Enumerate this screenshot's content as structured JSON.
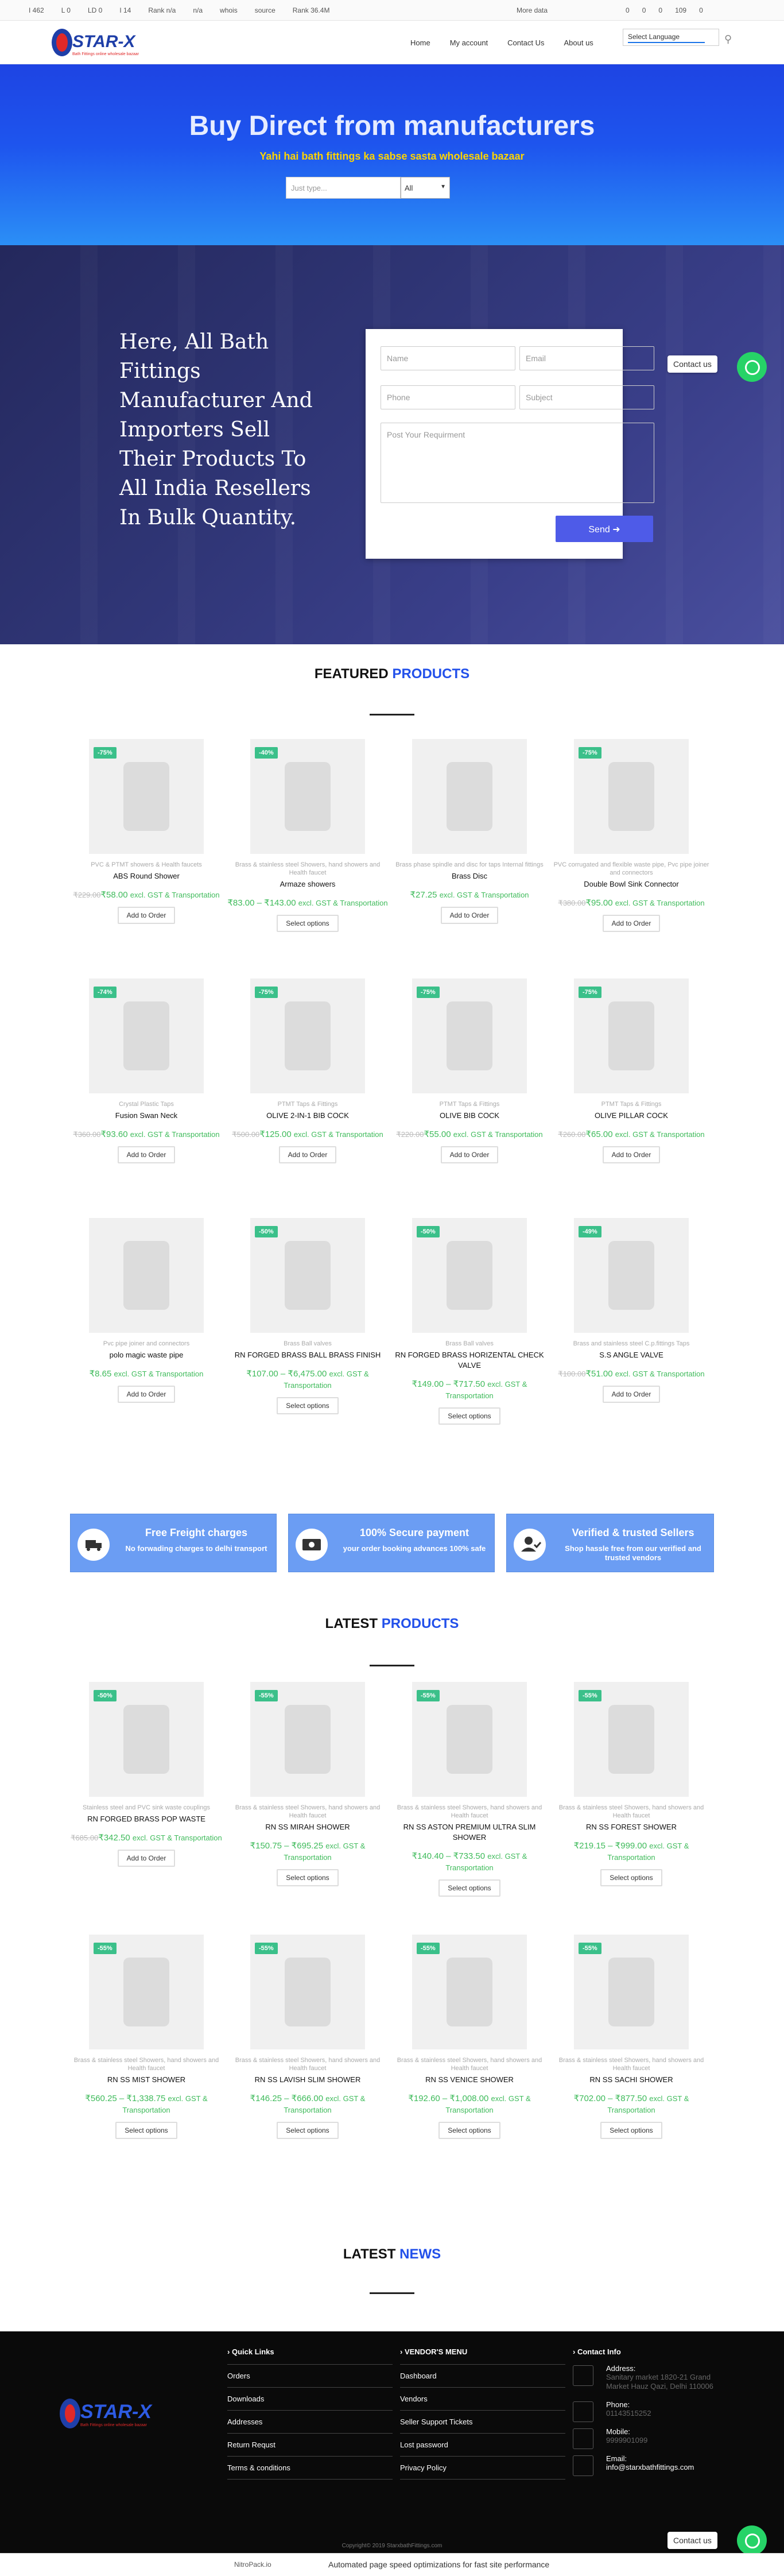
{
  "seo_bar": {
    "items": [
      {
        "icon": "google-icon",
        "label": "I 462"
      },
      {
        "icon": "pin-icon",
        "label": "L 0"
      },
      {
        "icon": "ld-icon",
        "label": "LD 0"
      },
      {
        "icon": "ext-icon",
        "label": "I 14"
      },
      {
        "icon": "rank-icon",
        "label": "Rank n/a"
      },
      {
        "icon": "facebook-icon",
        "label": "n/a"
      },
      {
        "icon": "whois-icon",
        "label": "whois"
      },
      {
        "icon": "source-icon",
        "label": "source"
      },
      {
        "icon": "rank2-icon",
        "label": "Rank 36.4M"
      }
    ],
    "more": "More data",
    "counts": [
      "0",
      "0",
      "0",
      "109",
      "0"
    ]
  },
  "header": {
    "logo_text": "STAR-X",
    "logo_tagline": "Bath Fittings online wholesale bazaar",
    "nav": [
      "Home",
      "My account",
      "Contact Us",
      "About us"
    ],
    "language": "Select Language"
  },
  "hero": {
    "title": "Buy Direct from manufacturers",
    "subtitle": "Yahi hai bath fittings ka sabse sasta wholesale bazaar",
    "search_placeholder": "Just type...",
    "search_select": "All"
  },
  "enquiry": {
    "headline": "Here, All Bath Fittings Manufacturer And Importers Sell Their Products To All India Resellers In Bulk Quantity.",
    "name": "Name",
    "email": "Email",
    "phone": "Phone",
    "subject": "Subject",
    "requirement": "Post Your Requirment",
    "send": "Send",
    "contact_label": "Contact us"
  },
  "featured": {
    "title_a": "FEATURED",
    "title_b": "PRODUCTS",
    "products": [
      {
        "badge": "-75%",
        "cat": "PVC & PTMT showers & Health faucets",
        "name": "ABS Round Shower",
        "old": "₹229.00",
        "price": "₹58.00",
        "tax": "excl. GST & Transportation",
        "btn": "Add to Order"
      },
      {
        "badge": "-40%",
        "cat": "Brass & stainless steel Showers, hand showers and Health faucet",
        "name": "Armaze showers",
        "old": "",
        "price": "₹83.00 – ₹143.00",
        "tax": "excl. GST & Transportation",
        "btn": "Select options"
      },
      {
        "badge": "",
        "cat": "Brass phase spindle and disc for taps Internal fittings",
        "name": "Brass Disc",
        "old": "",
        "price": "₹27.25",
        "tax": "excl. GST & Transportation",
        "btn": "Add to Order"
      },
      {
        "badge": "-75%",
        "cat": "PVC corrugated and flexible waste pipe, Pvc pipe joiner and connectors",
        "name": "Double Bowl Sink Connector",
        "old": "₹380.00",
        "price": "₹95.00",
        "tax": "excl. GST & Transportation",
        "btn": "Add to Order"
      },
      {
        "badge": "-74%",
        "cat": "Crystal Plastic Taps",
        "name": "Fusion Swan Neck",
        "old": "₹360.00",
        "price": "₹93.60",
        "tax": "excl. GST & Transportation",
        "btn": "Add to Order"
      },
      {
        "badge": "-75%",
        "cat": "PTMT Taps & Fittings",
        "name": "OLIVE 2-IN-1 BIB COCK",
        "old": "₹500.00",
        "price": "₹125.00",
        "tax": "excl. GST & Transportation",
        "btn": "Add to Order"
      },
      {
        "badge": "-75%",
        "cat": "PTMT Taps & Fittings",
        "name": "OLIVE BIB COCK",
        "old": "₹220.00",
        "price": "₹55.00",
        "tax": "excl. GST & Transportation",
        "btn": "Add to Order"
      },
      {
        "badge": "-75%",
        "cat": "PTMT Taps & Fittings",
        "name": "OLIVE PILLAR COCK",
        "old": "₹260.00",
        "price": "₹65.00",
        "tax": "excl. GST & Transportation",
        "btn": "Add to Order"
      },
      {
        "badge": "",
        "cat": "Pvc pipe joiner and connectors",
        "name": "polo magic waste pipe",
        "old": "",
        "price": "₹8.65",
        "tax": "excl. GST & Transportation",
        "btn": "Add to Order"
      },
      {
        "badge": "-50%",
        "cat": "Brass Ball valves",
        "name": "RN FORGED BRASS BALL BRASS FINISH",
        "old": "",
        "price": "₹107.00 – ₹6,475.00",
        "tax": "excl. GST & Transportation",
        "btn": "Select options"
      },
      {
        "badge": "-50%",
        "cat": "Brass Ball valves",
        "name": "RN FORGED BRASS HORIZENTAL CHECK VALVE",
        "old": "",
        "price": "₹149.00 – ₹717.50",
        "tax": "excl. GST & Transportation",
        "btn": "Select options"
      },
      {
        "badge": "-49%",
        "cat": "Brass and stainless steel C.p.fittings Taps",
        "name": "S.S ANGLE VALVE",
        "old": "₹100.00",
        "price": "₹51.00",
        "tax": "excl. GST & Transportation",
        "btn": "Add to Order"
      }
    ]
  },
  "features": [
    {
      "icon": "truck-icon",
      "title": "Free Freight charges",
      "text": "No forwading charges to delhi transport"
    },
    {
      "icon": "money-icon",
      "title": "100% Secure payment",
      "text": "your order booking advances 100% safe"
    },
    {
      "icon": "user-check-icon",
      "title": "Verified & trusted Sellers",
      "text": "Shop hassle free from our verified and trusted vendors"
    }
  ],
  "latest": {
    "title_a": "LATEST",
    "title_b": "PRODUCTS",
    "products": [
      {
        "badge": "-50%",
        "cat": "Stainless steel and PVC sink waste couplings",
        "name": "RN FORGED BRASS POP WASTE",
        "old": "₹685.00",
        "price": "₹342.50",
        "tax": "excl. GST & Transportation",
        "btn": "Add to Order"
      },
      {
        "badge": "-55%",
        "cat": "Brass & stainless steel Showers, hand showers and Health faucet",
        "name": "RN SS MIRAH SHOWER",
        "old": "",
        "price": "₹150.75 – ₹695.25",
        "tax": "excl. GST & Transportation",
        "btn": "Select options"
      },
      {
        "badge": "-55%",
        "cat": "Brass & stainless steel Showers, hand showers and Health faucet",
        "name": "RN SS ASTON PREMIUM ULTRA SLIM SHOWER",
        "old": "",
        "price": "₹140.40 – ₹733.50",
        "tax": "excl. GST & Transportation",
        "btn": "Select options"
      },
      {
        "badge": "-55%",
        "cat": "Brass & stainless steel Showers, hand showers and Health faucet",
        "name": "RN SS FOREST SHOWER",
        "old": "",
        "price": "₹219.15 – ₹999.00",
        "tax": "excl. GST & Transportation",
        "btn": "Select options"
      },
      {
        "badge": "-55%",
        "cat": "Brass & stainless steel Showers, hand showers and Health faucet",
        "name": "RN SS MIST SHOWER",
        "old": "",
        "price": "₹560.25 – ₹1,338.75",
        "tax": "excl. GST & Transportation",
        "btn": "Select options"
      },
      {
        "badge": "-55%",
        "cat": "Brass & stainless steel Showers, hand showers and Health faucet",
        "name": "RN SS LAVISH SLIM SHOWER",
        "old": "",
        "price": "₹146.25 – ₹666.00",
        "tax": "excl. GST & Transportation",
        "btn": "Select options"
      },
      {
        "badge": "-55%",
        "cat": "Brass & stainless steel Showers, hand showers and Health faucet",
        "name": "RN SS VENICE SHOWER",
        "old": "",
        "price": "₹192.60 – ₹1,008.00",
        "tax": "excl. GST & Transportation",
        "btn": "Select options"
      },
      {
        "badge": "-55%",
        "cat": "Brass & stainless steel Showers, hand showers and Health faucet",
        "name": "RN SS SACHI SHOWER",
        "old": "",
        "price": "₹702.00 – ₹877.50",
        "tax": "excl. GST & Transportation",
        "btn": "Select options"
      }
    ]
  },
  "news": {
    "title_a": "LATEST",
    "title_b": "NEWS"
  },
  "footer": {
    "quick_title": "Quick Links",
    "quick": [
      "Orders",
      "Downloads",
      "Addresses",
      "Return Requst",
      "Terms & conditions"
    ],
    "vendor_title": "VENDOR'S MENU",
    "vendor": [
      "Dashboard",
      "Vendors",
      "Seller Support Tickets",
      "Lost password",
      "Privacy Policy"
    ],
    "contact_title": "Contact Info",
    "contact": [
      {
        "icon": "location-icon",
        "label": "Address:",
        "value": "Sanitary market 1820-21 Grand Market Hauz Qazi, Delhi 110006"
      },
      {
        "icon": "phone-icon",
        "label": "Phone:",
        "value": "01143515252"
      },
      {
        "icon": "mobile-icon",
        "label": "Mobile:",
        "value": "9999901099"
      },
      {
        "icon": "mail-icon",
        "label": "Email:",
        "value": "info@starxbathfittings.com"
      }
    ],
    "copyright": "Copyright© 2019 StarxbathFittings.com"
  },
  "bottom_bar": {
    "brand": "NitroPack.io",
    "text": "Automated page speed optimizations for fast site performance"
  },
  "colors": {
    "accent": "#2250ea",
    "price": "#3fbb5b",
    "badge": "#3bc08a",
    "feature": "#6b9df3",
    "whatsapp": "#26d367"
  }
}
